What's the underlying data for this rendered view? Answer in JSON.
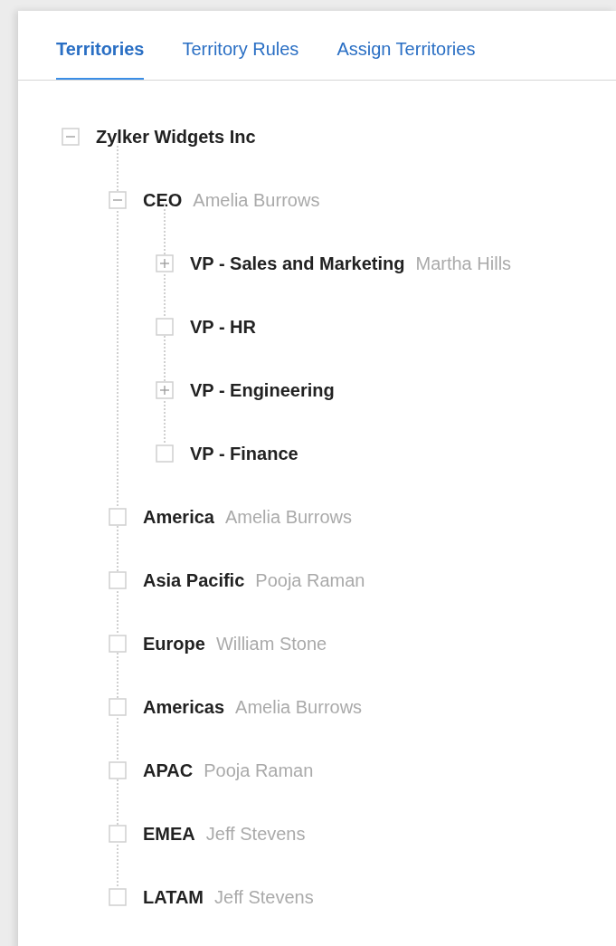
{
  "tabs": [
    {
      "label": "Territories",
      "selected": true
    },
    {
      "label": "Territory Rules",
      "selected": false
    },
    {
      "label": "Assign Territories",
      "selected": false
    }
  ],
  "tree": [
    {
      "name": "Zylker Widgets Inc",
      "kind": "branch",
      "expanded": true,
      "children": [
        {
          "name": "CEO",
          "owner": "Amelia Burrows",
          "kind": "branch",
          "expanded": true,
          "children": [
            {
              "name": "VP - Sales and Marketing",
              "owner": "Martha Hills",
              "kind": "branch",
              "expanded": false
            },
            {
              "name": "VP - HR",
              "kind": "leaf"
            },
            {
              "name": "VP - Engineering",
              "kind": "branch",
              "expanded": false
            },
            {
              "name": "VP - Finance",
              "kind": "leaf"
            }
          ]
        },
        {
          "name": "America",
          "owner": "Amelia Burrows",
          "kind": "leaf"
        },
        {
          "name": "Asia Pacific",
          "owner": "Pooja Raman",
          "kind": "leaf"
        },
        {
          "name": "Europe",
          "owner": "William Stone",
          "kind": "leaf"
        },
        {
          "name": "Americas",
          "owner": "Amelia Burrows",
          "kind": "leaf"
        },
        {
          "name": "APAC",
          "owner": "Pooja Raman",
          "kind": "leaf"
        },
        {
          "name": "EMEA",
          "owner": "Jeff Stevens",
          "kind": "leaf"
        },
        {
          "name": "LATAM",
          "owner": "Jeff Stevens",
          "kind": "leaf"
        }
      ]
    }
  ]
}
